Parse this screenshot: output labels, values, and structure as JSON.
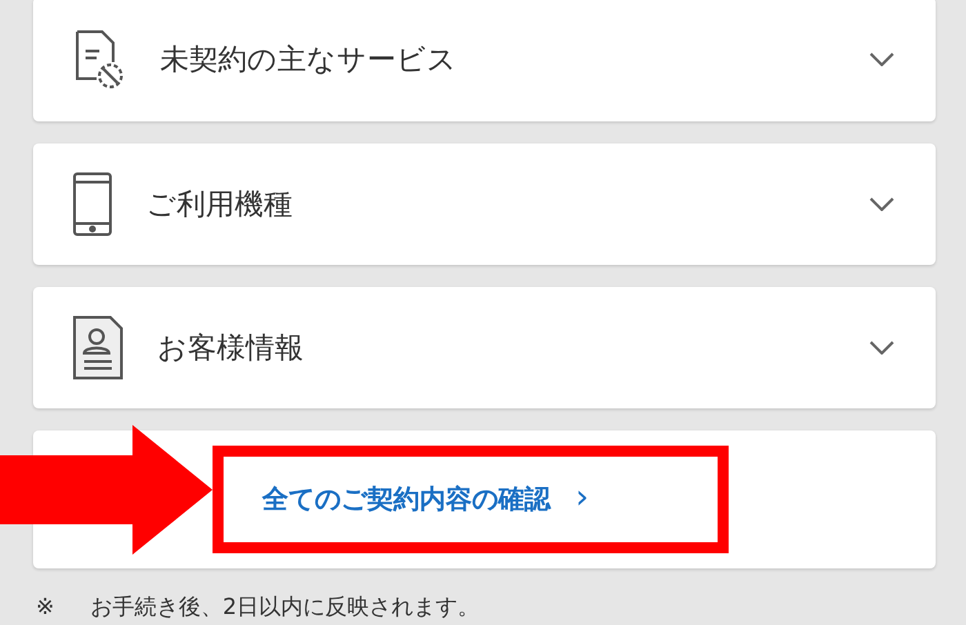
{
  "sections": [
    {
      "kind": "document",
      "label": "未契約の主なサービス",
      "expanded": false
    },
    {
      "kind": "phone",
      "label": "ご利用機種",
      "expanded": false
    },
    {
      "kind": "profile",
      "label": "お客様情報",
      "expanded": false
    }
  ],
  "link": {
    "label": "全てのご契約内容の確認",
    "chevron": "›"
  },
  "note": {
    "mark": "※",
    "text": "お手続き後、2日以内に反映されます。"
  }
}
